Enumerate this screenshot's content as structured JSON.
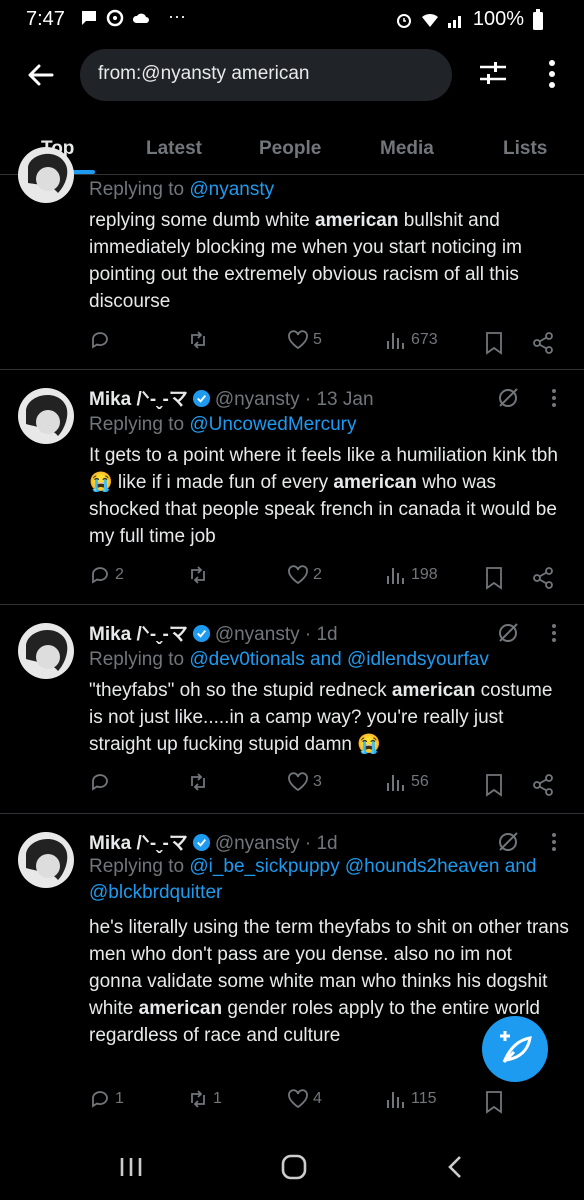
{
  "status": {
    "time": "7:47",
    "battery": "100%"
  },
  "search": {
    "query": "from:@nyansty american"
  },
  "tabs": [
    "Top",
    "Latest",
    "People",
    "Media",
    "Lists"
  ],
  "tweets": [
    {
      "reply_prefix": "Replying to ",
      "reply_to": "@nyansty",
      "reply_rest": "",
      "text_parts": [
        "replying some dumb white ",
        "american",
        " bullshit and immediately blocking me when you start noticing im pointing out the extremely obvious racism of all this discourse"
      ],
      "replies": "",
      "retweets": "",
      "likes": "5",
      "views": "673"
    },
    {
      "name": "Mika /ᐠ-ˬ-マ",
      "handle": "@nyansty · 13 Jan",
      "reply_prefix": "Replying to ",
      "reply_to": "@UncowedMercury",
      "reply_rest": "",
      "text_parts": [
        "It gets to a point where it feels like a humiliation kink tbh 😭 like if i made fun of every ",
        "american",
        " who was shocked that people speak french in canada it would be my full time job"
      ],
      "replies": "2",
      "retweets": "",
      "likes": "2",
      "views": "198"
    },
    {
      "name": "Mika /ᐠ-ˬ-マ",
      "handle": "@nyansty · 1d",
      "reply_prefix": "Replying to ",
      "reply_to": "@dev0tionals and @idlendsyourfav",
      "reply_rest": "",
      "text_parts": [
        "\"theyfabs\" oh so the stupid redneck ",
        "american",
        " costume is not just like.....in a camp way? you're really just straight up fucking stupid damn 😭"
      ],
      "replies": "",
      "retweets": "",
      "likes": "3",
      "views": "56"
    },
    {
      "name": "Mika /ᐠ-ˬ-マ",
      "handle": "@nyansty · 1d",
      "reply_prefix": "Replying to ",
      "reply_to": "@i_be_sickpuppy @hounds2heaven and @blckbrdquitter",
      "reply_rest": "",
      "text_parts": [
        "he's literally using the term theyfabs to shit on other trans men who don't pass are you dense. also no im not gonna validate some white man who thinks his dogshit white ",
        "american",
        " gender roles apply to the entire world regardless of race and culture"
      ],
      "replies": "1",
      "retweets": "1",
      "likes": "4",
      "views": "115"
    }
  ],
  "colors": {
    "accent": "#1d9bf0",
    "background": "#000000",
    "muted": "#71767b"
  }
}
